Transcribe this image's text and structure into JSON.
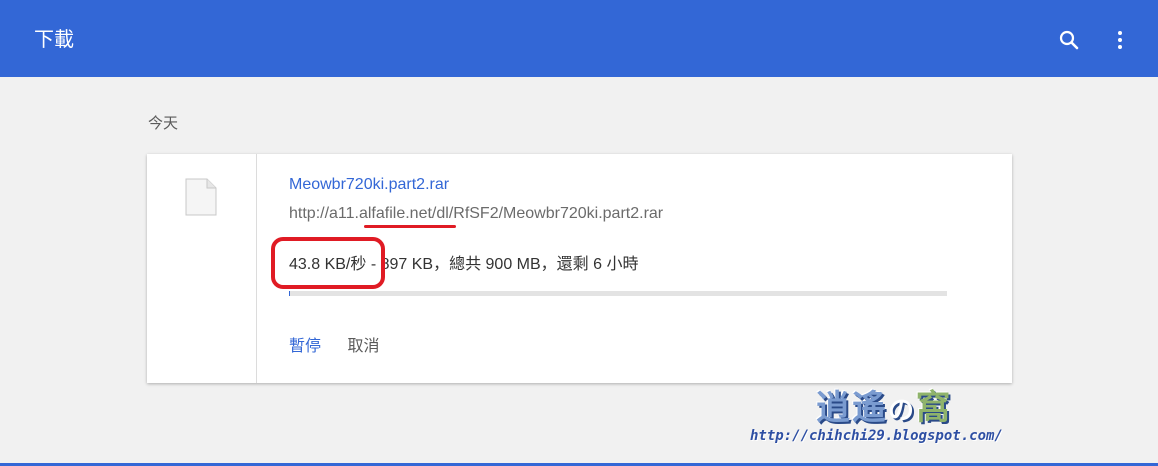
{
  "header": {
    "title": "下載",
    "search_icon": "search-icon",
    "more_icon": "more-vert-icon",
    "color": "#3367d6"
  },
  "section": {
    "label": "今天"
  },
  "download": {
    "file_icon": "file-icon",
    "file_name": "Meowbr720ki.part2.rar",
    "url": "http://a11.alfafile.net/dl/RfSF2/Meowbr720ki.part2.rar",
    "status": "43.8 KB/秒 - 897 KB，總共 900 MB，還剩 6 小時",
    "progress_fraction": 0.001,
    "pause_label": "暫停",
    "cancel_label": "取消"
  },
  "watermark": {
    "logo_part1": "逍遙",
    "logo_part2": "の",
    "logo_part3": "窩",
    "url": "http://chihchi29.blogspot.com/"
  },
  "annotation_color": "#e01b24"
}
